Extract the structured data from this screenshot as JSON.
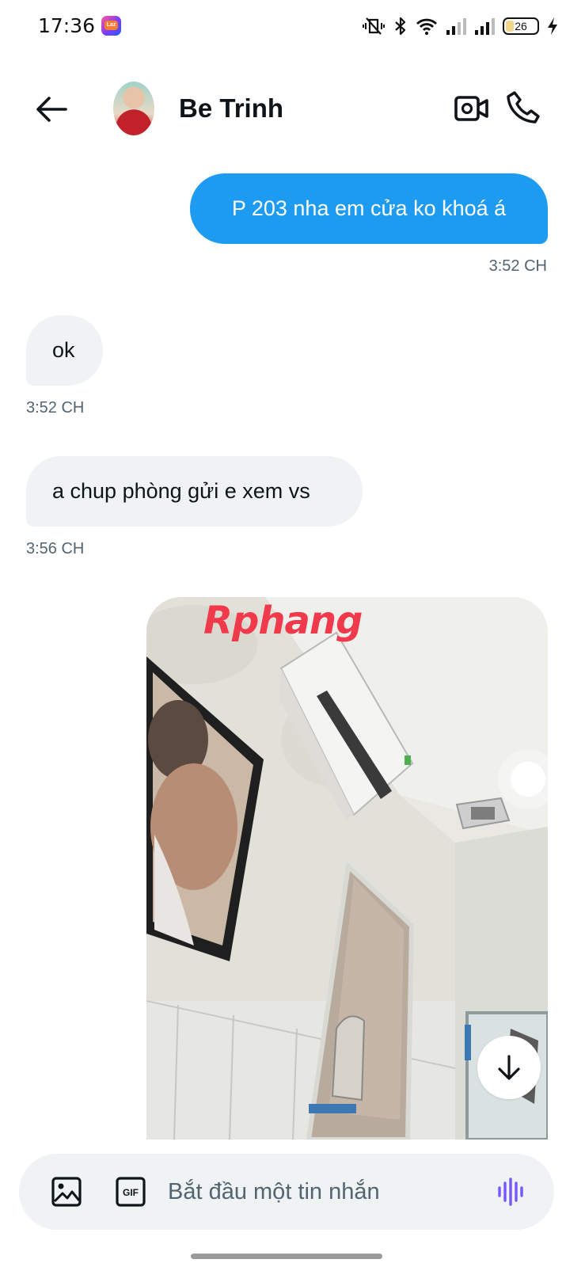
{
  "status_bar": {
    "time": "17:36",
    "battery": "26",
    "icons": [
      "lazada-app-icon",
      "vibrate-icon",
      "bluetooth-icon",
      "wifi-icon",
      "signal-icon",
      "signal-icon",
      "battery-icon",
      "charging-icon"
    ]
  },
  "header": {
    "contact_name": "Be Trinh",
    "back_icon": "arrow-left-icon",
    "video_icon": "video-camera-icon",
    "call_icon": "phone-icon"
  },
  "messages": [
    {
      "direction": "out",
      "text": "P 203 nha em cửa ko khoá á",
      "time": "3:52 CH"
    },
    {
      "direction": "in",
      "text": "ok",
      "time": "3:52 CH"
    },
    {
      "direction": "in",
      "text": "a chup phòng gửi e xem vs",
      "time": "3:56 CH"
    }
  ],
  "photo": {
    "watermark": "Rphang"
  },
  "composer": {
    "placeholder": "Bắt đầu một tin nhắn",
    "gif_label": "GIF"
  },
  "colors": {
    "accent": "#1d9bf0",
    "incoming_bubble": "#eff3f4",
    "timestamp": "#536471",
    "voice_icon": "#7856ff"
  }
}
